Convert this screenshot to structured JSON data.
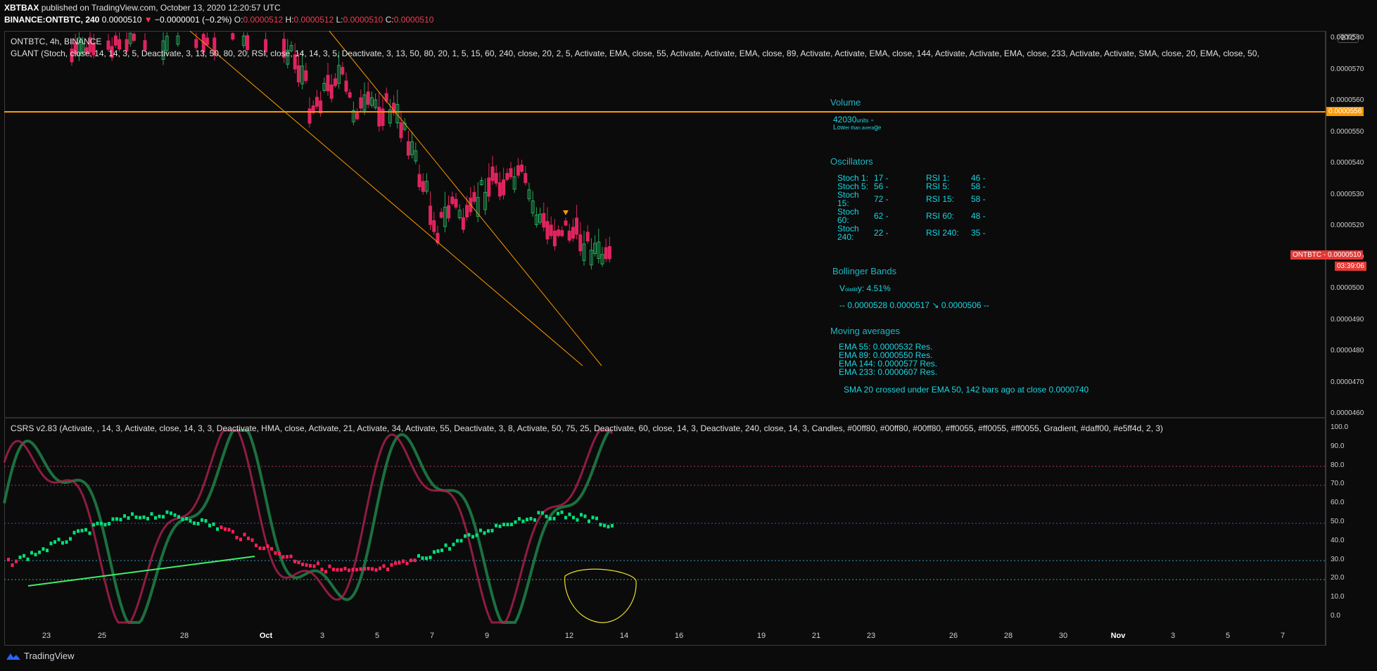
{
  "header": {
    "publisher": "XBTBAX",
    "published_text": "published on TradingView.com, October 13, 2020 12:20:57 UTC",
    "symbol_line": "BINANCE:ONTBTC, 240",
    "last": "0.0000510",
    "change_arrow": "▼",
    "change": "−0.0000001 (−0.2%)",
    "o_label": "O:",
    "o": "0.0000512",
    "h_label": "H:",
    "h": "0.0000512",
    "l_label": "L:",
    "l": "0.0000510",
    "c_label": "C:",
    "c": "0.0000510"
  },
  "price_pane": {
    "title": "ONTBTC, 4h, BINANCE",
    "indicator": "GLANT (Stoch, close, 14, 14, 3, 5, Deactivate, 3, 13, 50, 80, 20, RSI, close, 14, 14, 3, 5, Deactivate, 3, 13, 50, 80, 20, 1, 5, 15, 60, 240, close, 20, 2, 5, Activate, EMA, close, 55, Activate, Activate, EMA, close, 89, Activate, Activate, EMA, close, 144, Activate, Activate, EMA, close, 233, Activate, Activate, SMA, close, 20, EMA, close, 50,",
    "currency_badge": "BTC",
    "y_ticks": [
      "0.0000580",
      "0.0000570",
      "0.0000560",
      "0.0000550",
      "0.0000540",
      "0.0000530",
      "0.0000520",
      "0.0000510",
      "0.0000500",
      "0.0000490",
      "0.0000480",
      "0.0000470",
      "0.0000460"
    ],
    "hline_tag": "0.0000556",
    "price_tag_symbol": "ONTBTC",
    "price_tag": "0.0000510",
    "countdown": "03:39:06",
    "colors": {
      "up": "#26a65b",
      "down": "#e0245e",
      "hline": "#ff9800",
      "trend": "#ff9800",
      "panel_text": "#19d5e1"
    }
  },
  "info_panel": {
    "volume_title": "Volume",
    "volume_value": "42030",
    "volume_unit": "units",
    "volume_dash": "-",
    "volume_note_a": "L",
    "volume_note_b": "ow",
    "volume_note_c": "er than avera",
    "volume_note_d": "g",
    "volume_note_e": "e",
    "osc_title": "Oscillators",
    "stoch": [
      [
        "Stoch 1:",
        "17 -"
      ],
      [
        "Stoch 5:",
        "56 -"
      ],
      [
        "Stoch 15:",
        "72 -"
      ],
      [
        "Stoch 60:",
        "62 -"
      ],
      [
        "Stoch 240:",
        "22 -"
      ]
    ],
    "rsi": [
      [
        "RSI 1:",
        "46 -"
      ],
      [
        "RSI 5:",
        "58 -"
      ],
      [
        "RSI 15:",
        "58 -"
      ],
      [
        "RSI 60:",
        "48 -"
      ],
      [
        "RSI 240:",
        "35 -"
      ]
    ],
    "bb_title": "Bollinger Bands",
    "vol_a": "V",
    "vol_b": "olatilit",
    "vol_c": "y:  4.51%",
    "bb_line": "-- 0.0000528   0.0000517 ↘   0.0000506 --",
    "ma_title": "Moving averages",
    "ema": [
      "EMA 55:   0.0000532  Res.",
      "EMA 89:   0.0000550  Res.",
      "EMA 144:   0.0000577  Res.",
      "EMA 233:   0.0000607  Res."
    ],
    "cross_note": "SMA 20 crossed under EMA 50, 142 bars ago at close 0.0000740"
  },
  "osc_pane": {
    "title": "CSRS v2.83 (Activate, , 14, 3, Activate, close, 14, 3, 3, Deactivate, HMA, close, Activate, 21, Activate, 34, Activate, 55, Deactivate, 3, 8, Activate, 50, 75, 25, Deactivate, 60, close, 14, 3, Deactivate, 240, close, 14, 3, Candles, #00ff80, #00ff80, #00ff80, #ff0055, #ff0055, #ff0055, Gradient, #daff00, #e5ff4d, 2, 3)",
    "y_ticks": [
      "100.0",
      "90.0",
      "80.0",
      "70.0",
      "60.0",
      "50.0",
      "40.0",
      "30.0",
      "20.0",
      "10.0",
      "0.0"
    ]
  },
  "x_axis": {
    "labels": [
      "23",
      "25",
      "28",
      "Oct",
      "3",
      "5",
      "7",
      "9",
      "12",
      "14",
      "16",
      "19",
      "21",
      "23",
      "26",
      "28",
      "30",
      "Nov",
      "3",
      "5",
      "7"
    ]
  },
  "footer": {
    "brand": "TradingView"
  }
}
